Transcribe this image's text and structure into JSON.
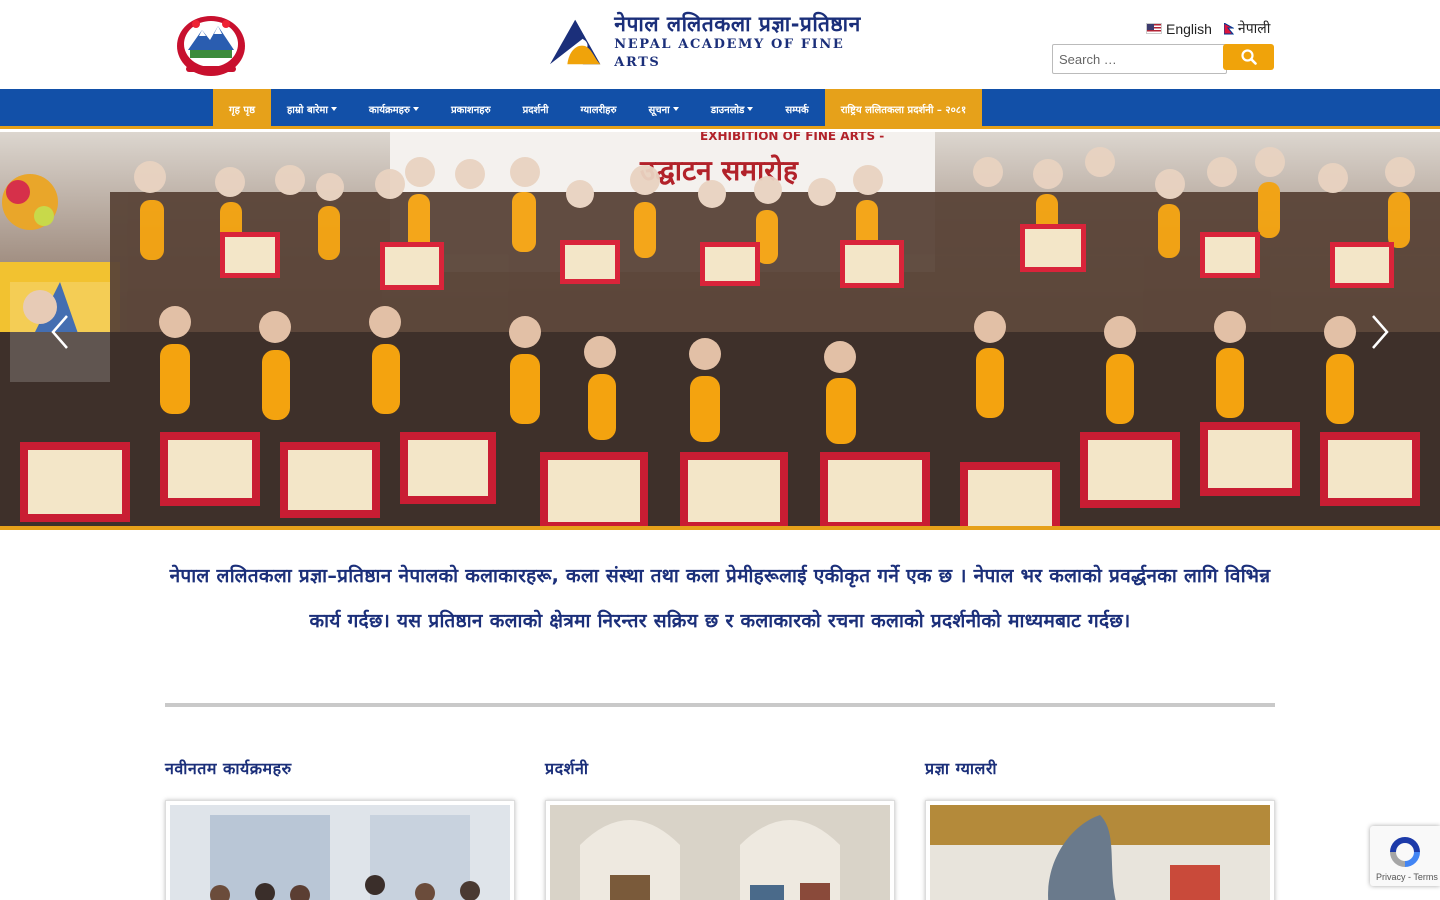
{
  "header": {
    "brand_nepali": "नेपाल ललितकला प्रज्ञा-प्रतिष्ठान",
    "brand_english": "NEPAL ACADEMY OF FINE ARTS",
    "languages": [
      {
        "label": "English",
        "flag": "us-flag-icon"
      },
      {
        "label": "नेपाली",
        "flag": "nepal-flag-icon"
      }
    ],
    "search": {
      "placeholder": "Search …"
    }
  },
  "nav": {
    "items": [
      {
        "label": "गृह पृष्ठ",
        "dropdown": false,
        "state": "active"
      },
      {
        "label": "हाम्रो बारेमा",
        "dropdown": true
      },
      {
        "label": "कार्यक्रमहरु",
        "dropdown": true
      },
      {
        "label": "प्रकाशनहरु",
        "dropdown": false
      },
      {
        "label": "प्रदर्शनी",
        "dropdown": false
      },
      {
        "label": "ग्यालरीहरु",
        "dropdown": false
      },
      {
        "label": "सूचना",
        "dropdown": true
      },
      {
        "label": "डाउनलोड",
        "dropdown": true
      },
      {
        "label": "सम्पर्क",
        "dropdown": false
      },
      {
        "label": "राष्ट्रिय ललितकला प्रदर्शनी – २०८१",
        "dropdown": false,
        "state": "highlight"
      }
    ]
  },
  "slider": {
    "banner_text": "उद्घाटन समारोह",
    "banner_english": "EXHIBITION OF FINE ARTS -"
  },
  "intro": {
    "text": "नेपाल ललितकला प्रज्ञा–प्रतिष्ठान नेपालको कलाकारहरू, कला संस्था तथा कला प्रेमीहरूलाई एकीकृत गर्ने एक छ । नेपाल भर कलाको प्रवर्द्धनका लागि विभिन्न कार्य गर्दछ। यस प्रतिष्ठान कलाको क्षेत्रमा निरन्तर सक्रिय छ र कलाकारको रचना कलाको प्रदर्शनीको माध्यमबाट गर्दछ।"
  },
  "columns": [
    {
      "title": "नवीनतम कार्यक्रमहरु"
    },
    {
      "title": "प्रदर्शनी"
    },
    {
      "title": "प्रज्ञा ग्यालरी"
    }
  ],
  "recaptcha": {
    "privacy": "Privacy",
    "terms": "Terms"
  },
  "colors": {
    "nav_blue": "#1250a8",
    "accent_orange": "#e6a11a",
    "text_navy": "#1b2f7a"
  }
}
